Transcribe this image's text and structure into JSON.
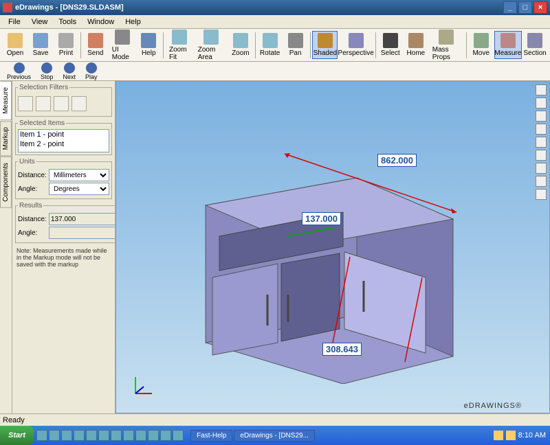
{
  "window": {
    "title": "eDrawings - [DNS29.SLDASM]"
  },
  "menus": [
    "File",
    "View",
    "Tools",
    "Window",
    "Help"
  ],
  "toolbar": [
    {
      "id": "open",
      "label": "Open"
    },
    {
      "id": "save",
      "label": "Save"
    },
    {
      "id": "print",
      "label": "Print"
    },
    {
      "sep": true
    },
    {
      "id": "send",
      "label": "Send"
    },
    {
      "id": "ui",
      "label": "UI Mode"
    },
    {
      "id": "help",
      "label": "Help"
    },
    {
      "sep": true
    },
    {
      "id": "fit",
      "label": "Zoom Fit"
    },
    {
      "id": "area",
      "label": "Zoom Area"
    },
    {
      "id": "zoom",
      "label": "Zoom"
    },
    {
      "sep": true
    },
    {
      "id": "rotate",
      "label": "Rotate"
    },
    {
      "id": "pan",
      "label": "Pan"
    },
    {
      "sep": true
    },
    {
      "id": "shaded",
      "label": "Shaded",
      "active": true
    },
    {
      "id": "persp",
      "label": "Perspective"
    },
    {
      "sep": true
    },
    {
      "id": "select",
      "label": "Select"
    },
    {
      "id": "home",
      "label": "Home"
    },
    {
      "id": "mass",
      "label": "Mass Props"
    },
    {
      "sep": true
    },
    {
      "id": "move",
      "label": "Move"
    },
    {
      "id": "measure",
      "label": "Measure",
      "active": true
    },
    {
      "id": "section",
      "label": "Section"
    }
  ],
  "nav": [
    {
      "id": "prev",
      "label": "Previous"
    },
    {
      "id": "stop",
      "label": "Stop"
    },
    {
      "id": "next",
      "label": "Next"
    },
    {
      "id": "play",
      "label": "Play"
    }
  ],
  "tabs": [
    {
      "id": "measure",
      "label": "Measure",
      "active": true
    },
    {
      "id": "markup",
      "label": "Markup"
    },
    {
      "id": "components",
      "label": "Components"
    }
  ],
  "panel": {
    "filters_title": "Selection Filters",
    "selected_title": "Selected Items",
    "selected": [
      "Item 1 - point",
      "Item 2 - point"
    ],
    "units_title": "Units",
    "distance_label": "Distance:",
    "angle_label": "Angle:",
    "distance_unit": "Millimeters",
    "angle_unit": "Degrees",
    "results_title": "Results",
    "result_distance": "137.000",
    "result_angle": "",
    "note": "Note: Measurements made while in the Markup mode will not be saved with the markup"
  },
  "dimensions": {
    "top": "862.000",
    "shelf": "137.000",
    "side": "308.643"
  },
  "brand": "eDRAWINGS®",
  "status": "Ready",
  "taskbar": {
    "start": "Start",
    "tasks": [
      "Fast-Help",
      "eDrawings - [DNS29..."
    ],
    "time": "8:10 AM"
  }
}
